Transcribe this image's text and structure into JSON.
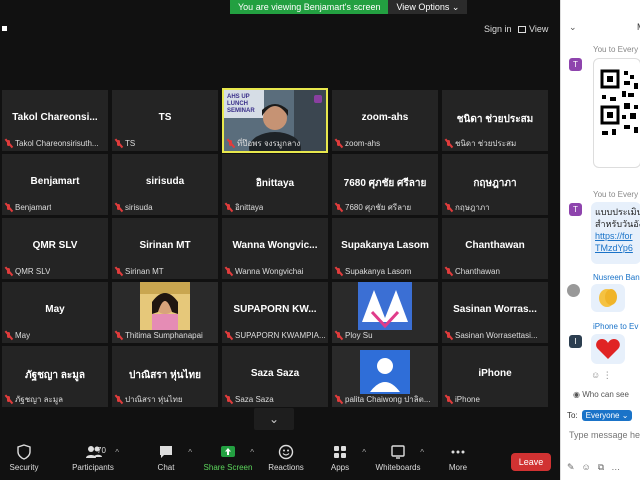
{
  "banner": {
    "message": "You are viewing Benjamart's screen",
    "options": "View Options"
  },
  "top_bar": {
    "sign_in": "Sign in",
    "view": "View"
  },
  "tiles": [
    {
      "name": "Takol Chareonsi...",
      "label": "Takol Chareonsirisuth...",
      "muted": true
    },
    {
      "name": "TS",
      "label": "TS",
      "muted": true
    },
    {
      "name": "",
      "label": "ที่ป๊อพร จงรมูกลาง",
      "muted": true,
      "video": "speaker",
      "active": true,
      "video_text": "AHS UP LUNCH SEMINAR"
    },
    {
      "name": "zoom-ahs",
      "label": "zoom-ahs",
      "muted": true
    },
    {
      "name": "ชนิดา ช่วยประสม",
      "label": "ชนิดา ช่วยประสม",
      "muted": true
    },
    {
      "name": "Benjamart",
      "label": "Benjamart",
      "muted": true
    },
    {
      "name": "sirisuda",
      "label": "sirisuda",
      "muted": true
    },
    {
      "name": "อิnittaya",
      "label": "อิnittaya",
      "muted": true
    },
    {
      "name": "7680 ศุภชัย ศรีลาย",
      "label": "7680 ศุภชัย ศรีลาย",
      "muted": true
    },
    {
      "name": "กฤษฎาภา",
      "label": "กฤษฎาภา",
      "muted": true
    },
    {
      "name": "QMR SLV",
      "label": "QMR SLV",
      "muted": true
    },
    {
      "name": "Sirinan MT",
      "label": "Sirinan MT",
      "muted": true
    },
    {
      "name": "Wanna Wongvic...",
      "label": "Wanna Wongvichai",
      "muted": true
    },
    {
      "name": "Supakanya Lasom",
      "label": "Supakanya Lasom",
      "muted": true
    },
    {
      "name": "Chanthawan",
      "label": "Chanthawan",
      "muted": true
    },
    {
      "name": "May",
      "label": "May",
      "muted": true
    },
    {
      "name": "",
      "label": "Thitima Sumphanapai",
      "muted": true,
      "video": "woman"
    },
    {
      "name": "SUPAPORN KW...",
      "label": "SUPAPORN KWAMPIA...",
      "muted": true
    },
    {
      "name": "",
      "label": "Ploy Su",
      "muted": true,
      "video": "art"
    },
    {
      "name": "Sasinan Worras...",
      "label": "Sasinan Worrasettasi...",
      "muted": true
    },
    {
      "name": "ภัฐชญา ละมูล",
      "label": "ภัฐชญา ละมูล",
      "muted": true
    },
    {
      "name": "ปาณิสรา หุ่นไทย",
      "label": "ปาณิสรา หุ่นไทย",
      "muted": true
    },
    {
      "name": "Saza Saza",
      "label": "Saza Saza",
      "muted": true
    },
    {
      "name": "",
      "label": "palita Chaiwong ปาลิต...",
      "muted": true,
      "video": "default-avatar"
    },
    {
      "name": "iPhone",
      "label": "iPhone",
      "muted": true
    }
  ],
  "toolbar": {
    "security": "Security",
    "participants": "Participants",
    "participants_count": "70",
    "chat": "Chat",
    "share": "Share Screen",
    "reactions": "Reactions",
    "apps": "Apps",
    "whiteboards": "Whiteboards",
    "more": "More",
    "leave": "Leave"
  },
  "chat": {
    "to1": "You to Every",
    "to2": "You to Every",
    "line1": "แบบประเมินโ",
    "line2": "สำหรับวันอัง",
    "link1": "https://for",
    "link2": "TMzdYp6",
    "sender3": "Nusreen Ban",
    "sender4": "iPhone to Ev",
    "who_can_see": "Who can see",
    "to_label": "To:",
    "to_value": "Everyone",
    "input_placeholder": "Type message her",
    "avatar_t": "T",
    "avatar_i": "I",
    "colors": {
      "accent": "#1a73c8",
      "avatar_t": "#8e44ad",
      "avatar_i": "#2c3e50",
      "leave": "#d13232",
      "share": "#23a041"
    }
  }
}
